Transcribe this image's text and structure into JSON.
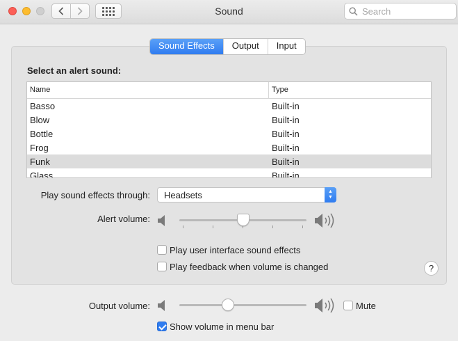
{
  "window": {
    "title": "Sound",
    "search_placeholder": "Search"
  },
  "tabs": [
    {
      "label": "Sound Effects",
      "active": true
    },
    {
      "label": "Output",
      "active": false
    },
    {
      "label": "Input",
      "active": false
    }
  ],
  "alert": {
    "heading": "Select an alert sound:",
    "columns": [
      "Name",
      "Type"
    ],
    "rows": [
      {
        "name": "Basso",
        "type": "Built-in",
        "selected": false
      },
      {
        "name": "Blow",
        "type": "Built-in",
        "selected": false
      },
      {
        "name": "Bottle",
        "type": "Built-in",
        "selected": false
      },
      {
        "name": "Frog",
        "type": "Built-in",
        "selected": false
      },
      {
        "name": "Funk",
        "type": "Built-in",
        "selected": true
      },
      {
        "name": "Glass",
        "type": "Built-in",
        "selected": false
      }
    ]
  },
  "play_through": {
    "label": "Play sound effects through:",
    "value": "Headsets"
  },
  "alert_volume": {
    "label": "Alert volume:",
    "level": 0.5
  },
  "options": {
    "ui_sounds": {
      "label": "Play user interface sound effects",
      "checked": false
    },
    "feedback": {
      "label": "Play feedback when volume is changed",
      "checked": false
    }
  },
  "help": "?",
  "output_volume": {
    "label": "Output volume:",
    "level": 0.38,
    "mute_label": "Mute",
    "mute_checked": false
  },
  "menu_bar": {
    "label": "Show volume in menu bar",
    "checked": true
  },
  "icons": [
    "back-icon",
    "forward-icon",
    "grid-icon",
    "search-icon",
    "speaker-low-icon",
    "speaker-high-icon"
  ]
}
